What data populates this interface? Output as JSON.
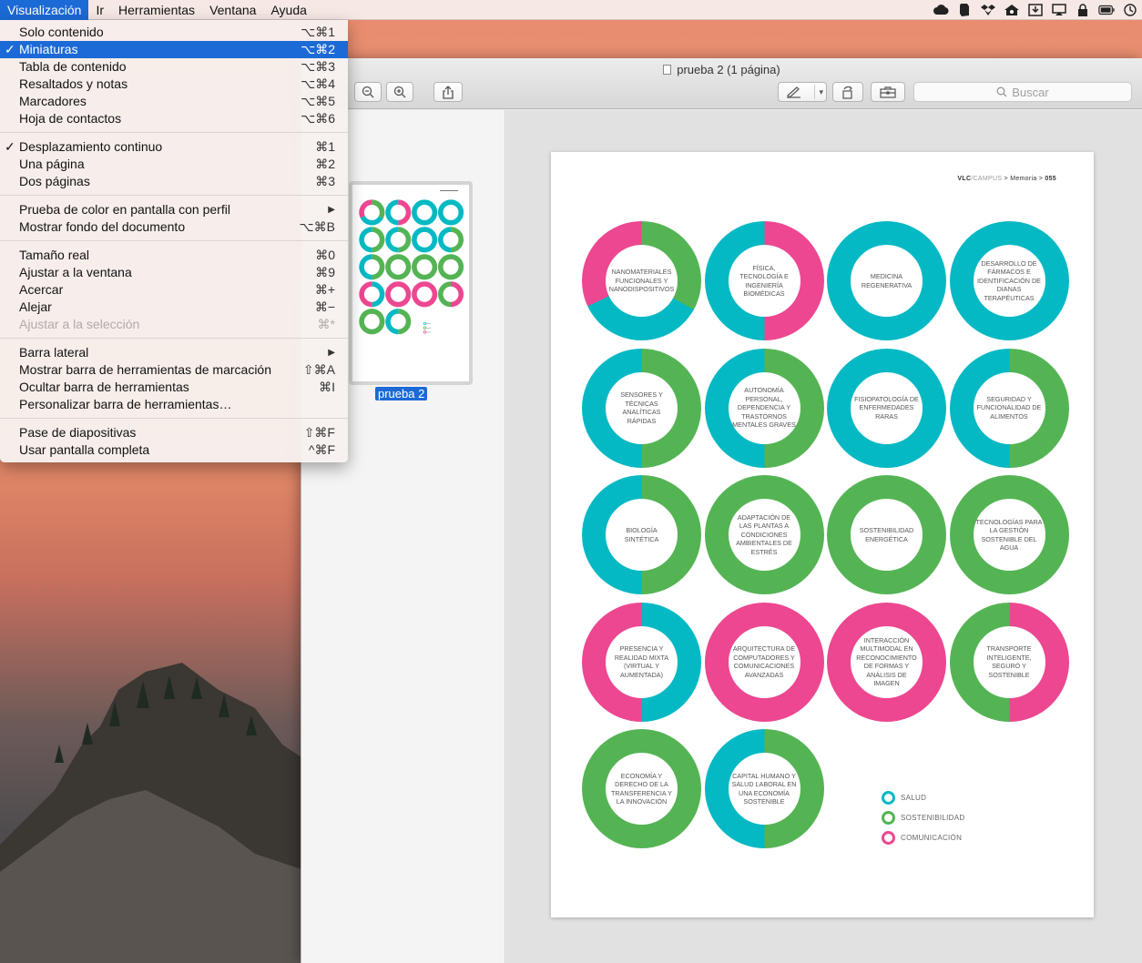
{
  "menubar": {
    "items": [
      "Visualización",
      "Ir",
      "Herramientas",
      "Ventana",
      "Ayuda"
    ],
    "status_icons": [
      "creative-cloud-icon",
      "evernote-icon",
      "dropbox-icon",
      "houseparty-icon",
      "download-icon",
      "airplay-icon",
      "lock-icon",
      "battery-icon",
      "time-machine-icon"
    ]
  },
  "view_menu": {
    "groups": [
      [
        {
          "label": "Solo contenido",
          "shortcut": "⌥⌘1"
        },
        {
          "label": "Miniaturas",
          "shortcut": "⌥⌘2",
          "checked": true,
          "selected": true
        },
        {
          "label": "Tabla de contenido",
          "shortcut": "⌥⌘3"
        },
        {
          "label": "Resaltados y notas",
          "shortcut": "⌥⌘4"
        },
        {
          "label": "Marcadores",
          "shortcut": "⌥⌘5"
        },
        {
          "label": "Hoja de contactos",
          "shortcut": "⌥⌘6"
        }
      ],
      [
        {
          "label": "Desplazamiento continuo",
          "shortcut": "⌘1",
          "checked": true
        },
        {
          "label": "Una página",
          "shortcut": "⌘2"
        },
        {
          "label": "Dos páginas",
          "shortcut": "⌘3"
        }
      ],
      [
        {
          "label": "Prueba de color en pantalla con perfil",
          "shortcut": "▶"
        },
        {
          "label": "Mostrar fondo del documento",
          "shortcut": "⌥⌘B"
        }
      ],
      [
        {
          "label": "Tamaño real",
          "shortcut": "⌘0"
        },
        {
          "label": "Ajustar a la ventana",
          "shortcut": "⌘9"
        },
        {
          "label": "Acercar",
          "shortcut": "⌘+"
        },
        {
          "label": "Alejar",
          "shortcut": "⌘−"
        },
        {
          "label": "Ajustar a la selección",
          "shortcut": "⌘*",
          "disabled": true
        }
      ],
      [
        {
          "label": "Barra lateral",
          "shortcut": "▶"
        },
        {
          "label": "Mostrar barra de herramientas de marcación",
          "shortcut": "⇧⌘A"
        },
        {
          "label": "Ocultar barra de herramientas",
          "shortcut": "⌘I"
        },
        {
          "label": "Personalizar barra de herramientas…",
          "shortcut": ""
        }
      ],
      [
        {
          "label": "Pase de diapositivas",
          "shortcut": "⇧⌘F"
        },
        {
          "label": "Usar pantalla completa",
          "shortcut": "^⌘F"
        }
      ]
    ]
  },
  "window": {
    "title": "prueba 2 (1 página)",
    "search_placeholder": "Buscar",
    "thumbnail_label": "prueba 2"
  },
  "document": {
    "header": {
      "brand": "VLC",
      "campus": "/CAMPUS",
      "path": " > Memoria > ",
      "page": "055"
    },
    "colors": {
      "salud": "#05b9c4",
      "sostenibilidad": "#54b454",
      "comunicacion": "#ec4790"
    },
    "rings": [
      {
        "label": "Nanomateriales funcionales y nanodispositivos",
        "segments": [
          [
            "sostenibilidad",
            0.33
          ],
          [
            "salud",
            0.35
          ],
          [
            "comunicacion",
            0.32
          ]
        ]
      },
      {
        "label": "Física, tecnología e ingeniería biomédicas",
        "segments": [
          [
            "comunicacion",
            0.5
          ],
          [
            "salud",
            0.5
          ]
        ]
      },
      {
        "label": "Medicina regenerativa",
        "segments": [
          [
            "salud",
            1
          ]
        ]
      },
      {
        "label": "Desarrollo de fármacos e identificación de dianas terapéuticas",
        "segments": [
          [
            "salud",
            1
          ]
        ]
      },
      {
        "label": "Sensores y técnicas analíticas rápidas",
        "segments": [
          [
            "sostenibilidad",
            0.5
          ],
          [
            "salud",
            0.5
          ]
        ]
      },
      {
        "label": "Autonomía personal, dependencia y trastornos mentales graves",
        "segments": [
          [
            "sostenibilidad",
            0.5
          ],
          [
            "salud",
            0.5
          ]
        ]
      },
      {
        "label": "Fisiopatología de enfermedades raras",
        "segments": [
          [
            "salud",
            1
          ]
        ]
      },
      {
        "label": "Seguridad y funcionalidad de alimentos",
        "segments": [
          [
            "sostenibilidad",
            0.5
          ],
          [
            "salud",
            0.5
          ]
        ]
      },
      {
        "label": "Biología sintética",
        "segments": [
          [
            "sostenibilidad",
            0.5
          ],
          [
            "salud",
            0.5
          ]
        ]
      },
      {
        "label": "Adaptación de las plantas a condiciones ambientales de estrés",
        "segments": [
          [
            "sostenibilidad",
            1
          ]
        ]
      },
      {
        "label": "Sostenibilidad energética",
        "segments": [
          [
            "sostenibilidad",
            1
          ]
        ]
      },
      {
        "label": "Tecnologías para la gestión sostenible del agua",
        "segments": [
          [
            "sostenibilidad",
            1
          ]
        ]
      },
      {
        "label": "Presencia y realidad mixta (virtual y aumentada)",
        "segments": [
          [
            "salud",
            0.5
          ],
          [
            "comunicacion",
            0.5
          ]
        ]
      },
      {
        "label": "Arquitectura de computadores y comunicaciones avanzadas",
        "segments": [
          [
            "comunicacion",
            1
          ]
        ]
      },
      {
        "label": "Interacción multimodal en reconocimiento de formas y análisis de imagen",
        "segments": [
          [
            "comunicacion",
            1
          ]
        ]
      },
      {
        "label": "Transporte inteligente, seguro y sostenible",
        "segments": [
          [
            "comunicacion",
            0.5
          ],
          [
            "sostenibilidad",
            0.5
          ]
        ]
      },
      {
        "label": "Economía y derecho de la transferencia y la innovación",
        "segments": [
          [
            "sostenibilidad",
            1
          ]
        ]
      },
      {
        "label": "Capital humano y salud laboral en una economía sostenible",
        "segments": [
          [
            "sostenibilidad",
            0.5
          ],
          [
            "salud",
            0.5
          ]
        ]
      }
    ],
    "legend": [
      {
        "key": "salud",
        "label": "SALUD"
      },
      {
        "key": "sostenibilidad",
        "label": "SOSTENIBILIDAD"
      },
      {
        "key": "comunicacion",
        "label": "COMUNICACIÓN"
      }
    ]
  }
}
